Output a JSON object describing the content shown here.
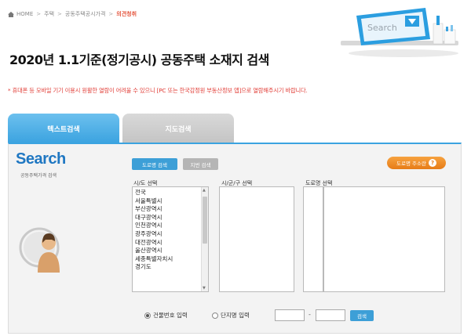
{
  "breadcrumb": {
    "home": "HOME",
    "housing": "주택",
    "public_price": "공동주택공시가격",
    "current": "의견청취"
  },
  "hero": {
    "search_text": "Search"
  },
  "page": {
    "title": "2020년 1.1기준(정기공시) 공동주택 소재지 검색",
    "notice": "* 휴대폰 등 모바일 기기 이용시 원활한 열람이 어려울 수 있으니 [PC 또는 한국감정원 부동산정보 앱]으로 열람해주시기 바랍니다."
  },
  "tabs": {
    "text_search": "텍스트검색",
    "map_search": "지도검색"
  },
  "panel": {
    "logo": "Search",
    "logo_sub": "공동주택가격 검색",
    "btn_road": "도로명 검색",
    "btn_lot": "지번 검색",
    "btn_addr_guide": "도로명 주소란",
    "label_sido": "시/도 선택",
    "label_sigungu": "시/군/구 선택",
    "label_road": "도로명 선택",
    "sido_items": [
      "전국",
      "서울특별시",
      "부산광역시",
      "대구광역시",
      "인천광역시",
      "광주광역시",
      "대전광역시",
      "울산광역시",
      "세종특별자치시",
      "경기도"
    ],
    "radio_building": "건물번호 입력",
    "radio_complex": "단지명 입력",
    "dash": "-",
    "btn_search": "검색"
  },
  "colors": {
    "accent": "#3ba3e0",
    "notice": "#e2403a",
    "orange": "#e77c17",
    "logo": "#1f77c2"
  }
}
